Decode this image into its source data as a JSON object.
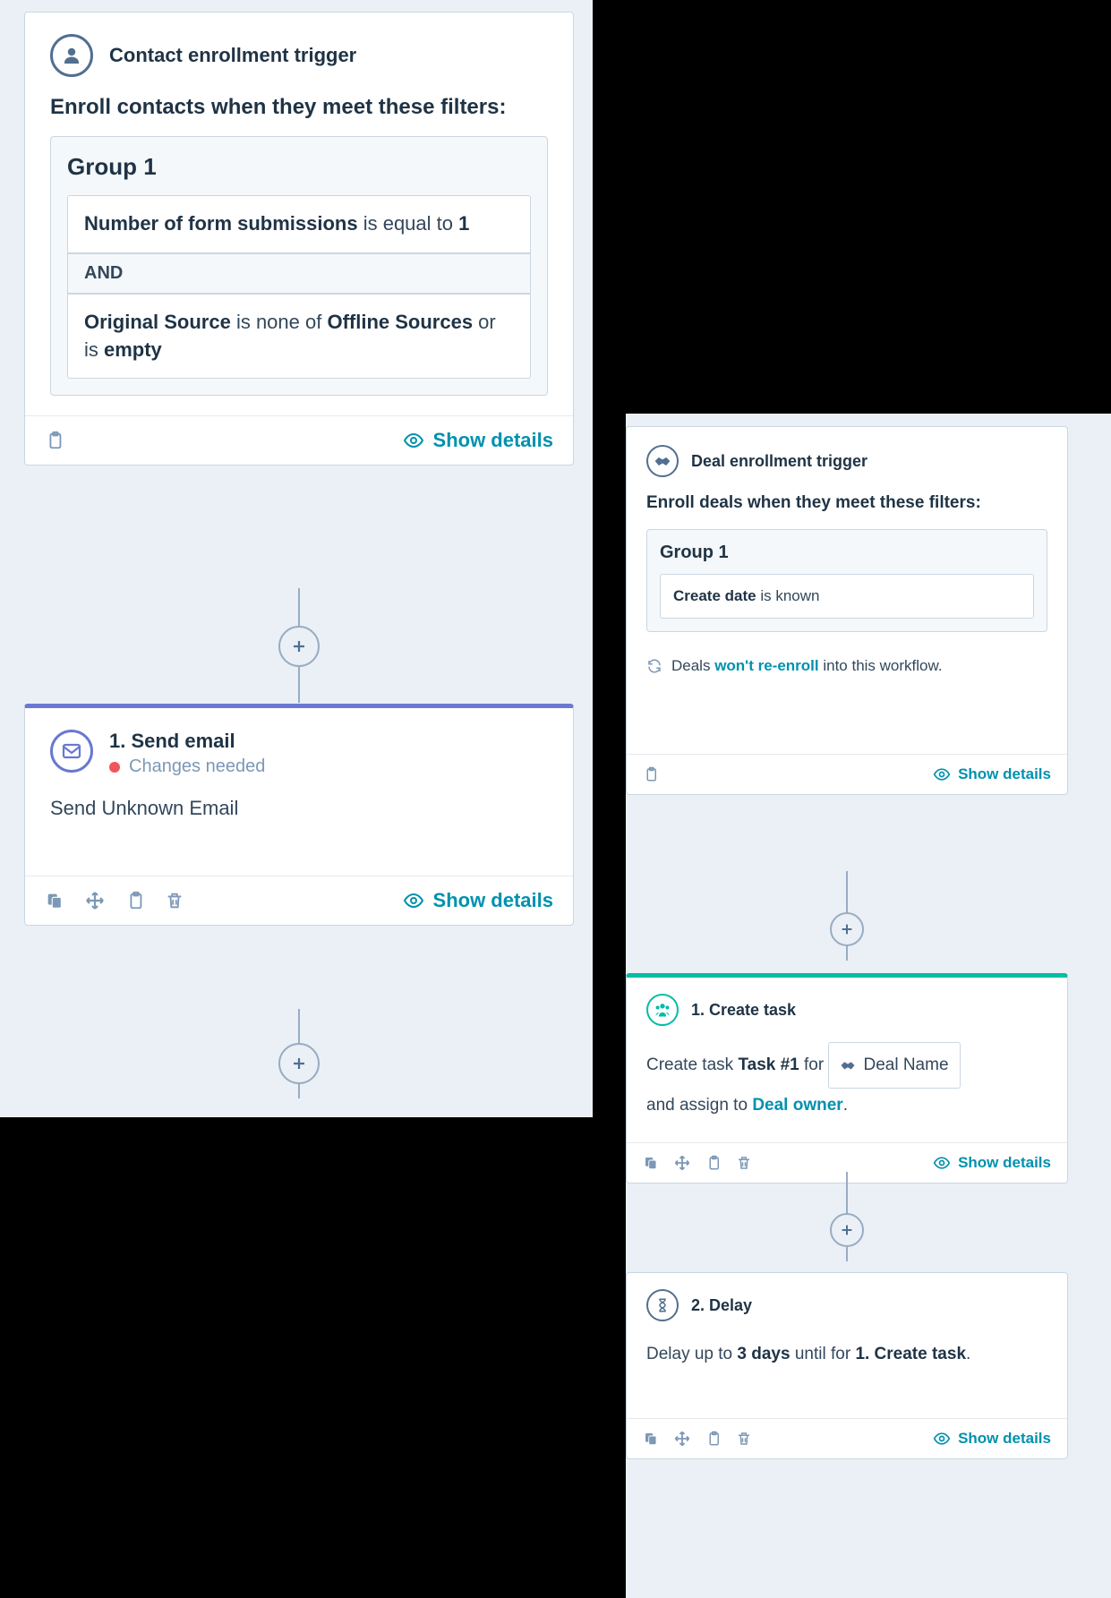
{
  "left": {
    "trigger": {
      "title": "Contact enrollment trigger",
      "subtitle": "Enroll contacts when they meet these filters:",
      "group_title": "Group 1",
      "filter1_prop": "Number of form submissions",
      "filter1_text": " is equal to ",
      "filter1_val": "1",
      "and": "AND",
      "filter2_prop": "Original Source",
      "filter2_mid": " is none of ",
      "filter2_val1": "Offline Sources",
      "filter2_or": " or is ",
      "filter2_val2": "empty",
      "show_details": "Show details"
    },
    "email": {
      "title": "1. Send email",
      "changes": "Changes needed",
      "desc": "Send Unknown Email",
      "show_details": "Show details"
    }
  },
  "right": {
    "trigger": {
      "title": "Deal enrollment trigger",
      "subtitle": "Enroll deals when they meet these filters:",
      "group_title": "Group 1",
      "filter_prop": "Create date",
      "filter_text": " is known",
      "reenroll_pre": "Deals ",
      "reenroll_link": "won't re-enroll",
      "reenroll_post": " into this workflow.",
      "show_details": "Show details"
    },
    "task": {
      "title": "1. Create task",
      "pre": "Create task ",
      "task_name": "Task #1",
      "for": " for ",
      "chip": "Deal Name",
      "assign_pre": "and assign to ",
      "assign_link": "Deal owner",
      "period": ".",
      "show_details": "Show details"
    },
    "delay": {
      "title": "2. Delay",
      "pre": "Delay up to ",
      "duration": "3 days",
      "mid": " until for ",
      "ref": "1. Create task",
      "period": ".",
      "show_details": "Show details"
    }
  }
}
